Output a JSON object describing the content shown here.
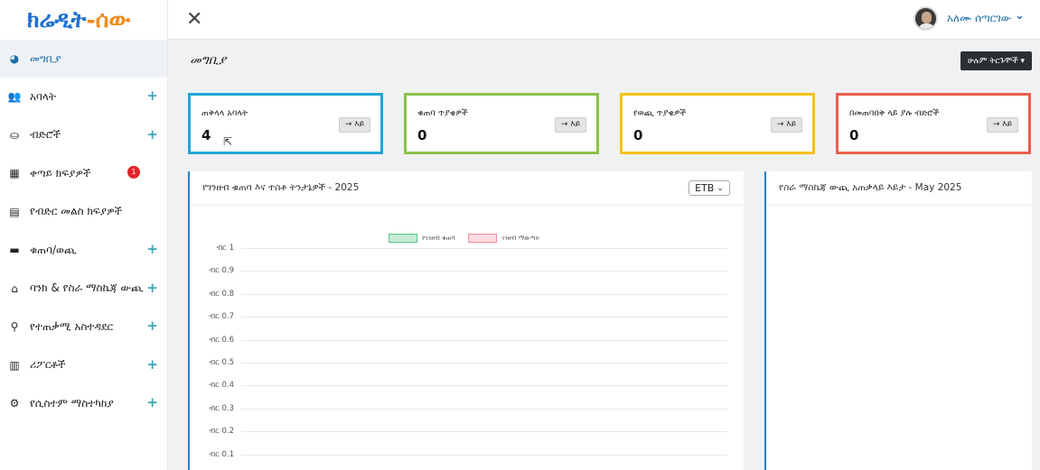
{
  "brand": {
    "part1": "ክሬዲት",
    "sep": "-",
    "part2": "ሰው"
  },
  "sidebar": {
    "items": [
      {
        "label": "መግቢያ",
        "icon": "dashboard-icon",
        "active": true
      },
      {
        "label": "አባላት",
        "icon": "users-icon",
        "plus": true
      },
      {
        "label": "ብድሮች",
        "icon": "hand-coin-icon",
        "plus": true
      },
      {
        "label": "ቀጣይ ክፍያዎች",
        "icon": "calendar-icon",
        "badge": "1"
      },
      {
        "label": "የብድር መልስ ክፍያዎች",
        "icon": "receipt-icon"
      },
      {
        "label": "ቁጠባ/ወጪ",
        "icon": "wallet-icon",
        "plus": true
      },
      {
        "label": "ባንክ & የስራ ማስኬጃ ውጪ",
        "icon": "bank-icon",
        "plus": true
      },
      {
        "label": "የተጠቃሚ አስተዳደር",
        "icon": "user-icon",
        "plus": true
      },
      {
        "label": "ሪፖርቶች",
        "icon": "bar-chart-icon",
        "plus": true
      },
      {
        "label": "የሲስተም ማስተካከያ",
        "icon": "gear-icon",
        "plus": true
      }
    ]
  },
  "topbar": {
    "username": "አለሙ ሰጣርገው"
  },
  "page": {
    "title": "መግቢያ",
    "all_translations": "ሁሉም ትርጉሞች"
  },
  "cards": [
    {
      "label": "ጠቅላላ አባላት",
      "value": "4",
      "button": "→ እይ",
      "color": "#23a6d5"
    },
    {
      "label": "ቁጠባ ጥያቄዎች",
      "value": "0",
      "button": "→ እይ",
      "color": "#8bc34a"
    },
    {
      "label": "የወጪ ጥያቄዎች",
      "value": "0",
      "button": "→ እይ",
      "color": "#f5c21b"
    },
    {
      "label": "በመጠባበቅ ላይ ያሉ ብድሮች",
      "value": "0",
      "button": "→ እይ",
      "color": "#e8604c"
    }
  ],
  "chart_panel": {
    "title": "የገንዘብ ቁጠባ እና ተስቶ ትንታኔዎች - 2025",
    "currency": "ETB",
    "legend": [
      {
        "name": "የገንዘብ ቁጠባ",
        "fill": "#c6ecd8",
        "stroke": "#5cc48a"
      },
      {
        "name": "ገንዘብ ማውጣት",
        "fill": "#fbdbe0",
        "stroke": "#f08aa0"
      }
    ]
  },
  "summary_panel": {
    "title": "የስራ ማስኬጃ ውጪ አጠቃላይ እይታ - May 2025"
  },
  "chart_data": {
    "type": "line",
    "title": "የገንዘብ ቁጠባ እና ተስቶ ትንታኔዎች - 2025",
    "y_tick_labels": [
      "ብር 1",
      "ብር 0.9",
      "ብር 0.8",
      "ብር 0.7",
      "ብር 0.6",
      "ብር 0.5",
      "ብር 0.4",
      "ብር 0.3",
      "ብር 0.2",
      "ብር 0.1"
    ],
    "ylim": [
      0,
      1
    ],
    "series": [
      {
        "name": "የገንዘብ ቁጠባ",
        "values": []
      },
      {
        "name": "ገንዘብ ማውጣት",
        "values": []
      }
    ],
    "grid": true,
    "legend_position": "top"
  }
}
